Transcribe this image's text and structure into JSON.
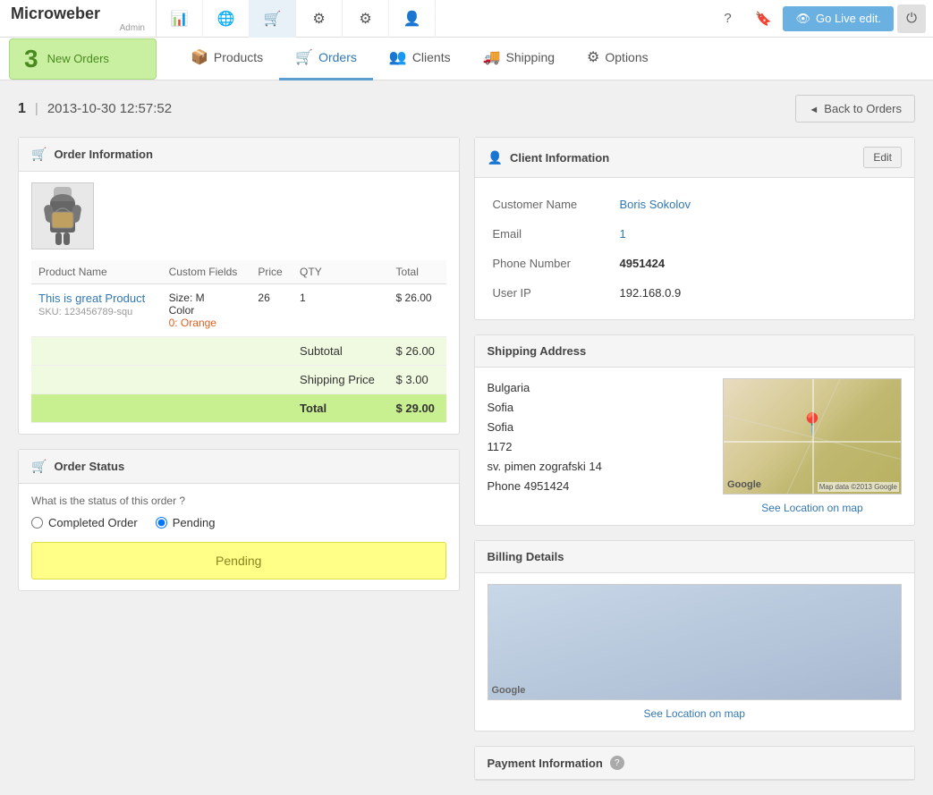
{
  "app": {
    "logo": "Microweber",
    "logo_suffix": "Admin"
  },
  "topnav": {
    "icons": [
      {
        "name": "chart-icon",
        "symbol": "📊"
      },
      {
        "name": "globe-icon",
        "symbol": "🌐"
      },
      {
        "name": "cart-icon",
        "symbol": "🛒"
      },
      {
        "name": "nodes-icon",
        "symbol": "⚙"
      },
      {
        "name": "settings-icon",
        "symbol": "⚙"
      },
      {
        "name": "user-icon",
        "symbol": "👤"
      }
    ],
    "right": {
      "help_symbol": "?",
      "bookmark_symbol": "🔖",
      "go_live_label": "Go Live edit.",
      "eye_symbol": "👁",
      "power_symbol": "⏻"
    }
  },
  "tabs_bar": {
    "badge": {
      "count": "3",
      "label": "New Orders"
    },
    "tabs": [
      {
        "id": "products",
        "label": "Products",
        "icon": "📦",
        "active": false
      },
      {
        "id": "orders",
        "label": "Orders",
        "icon": "🛒",
        "active": true
      },
      {
        "id": "clients",
        "label": "Clients",
        "icon": "👥",
        "active": false
      },
      {
        "id": "shipping",
        "label": "Shipping",
        "icon": "🚚",
        "active": false
      },
      {
        "id": "options",
        "label": "Options",
        "icon": "⚙",
        "active": false
      }
    ]
  },
  "order": {
    "id": "1",
    "datetime": "2013-10-30 12:57:52",
    "back_button": "Back to Orders",
    "info_panel_title": "Order Information",
    "table": {
      "headers": [
        "Product Name",
        "Custom Fields",
        "Price",
        "QTY",
        "Total"
      ],
      "rows": [
        {
          "product_name": "This is great Product",
          "sku": "SKU: 123456789-squ",
          "custom_fields": "Size: M\nColor\n0: Orange",
          "size": "Size: M",
          "color_label": "Color",
          "color_value": "0: Orange",
          "price": "26",
          "qty": "1",
          "total": "$ 26.00"
        }
      ],
      "subtotal_label": "Subtotal",
      "subtotal_value": "$ 26.00",
      "shipping_label": "Shipping Price",
      "shipping_value": "$ 3.00",
      "total_label": "Total",
      "total_value": "$ 29.00"
    },
    "status": {
      "panel_title": "Order Status",
      "question": "What is the status of this order ?",
      "options": [
        "Completed Order",
        "Pending"
      ],
      "selected": "Pending",
      "badge_text": "Pending"
    }
  },
  "client": {
    "panel_title": "Client Information",
    "edit_label": "Edit",
    "customer_name_label": "Customer Name",
    "customer_name": "Boris Sokolov",
    "email_label": "Email",
    "email": "1",
    "phone_label": "Phone Number",
    "phone": "4951424",
    "ip_label": "User IP",
    "ip": "192.168.0.9",
    "shipping_address_label": "Shipping Address",
    "address": {
      "country": "Bulgaria",
      "city1": "Sofia",
      "city2": "Sofia",
      "postal": "1172",
      "street": "sv. pimen zografski 14",
      "phone_prefix": "Phone",
      "phone": "4951424"
    },
    "see_location_label": "See Location on map",
    "map_data_label": "Map data ©2013 Google",
    "billing_label": "Billing Details",
    "billing_see_location": "See Location on map",
    "payment_label": "Payment Information",
    "payment_help": "?"
  }
}
